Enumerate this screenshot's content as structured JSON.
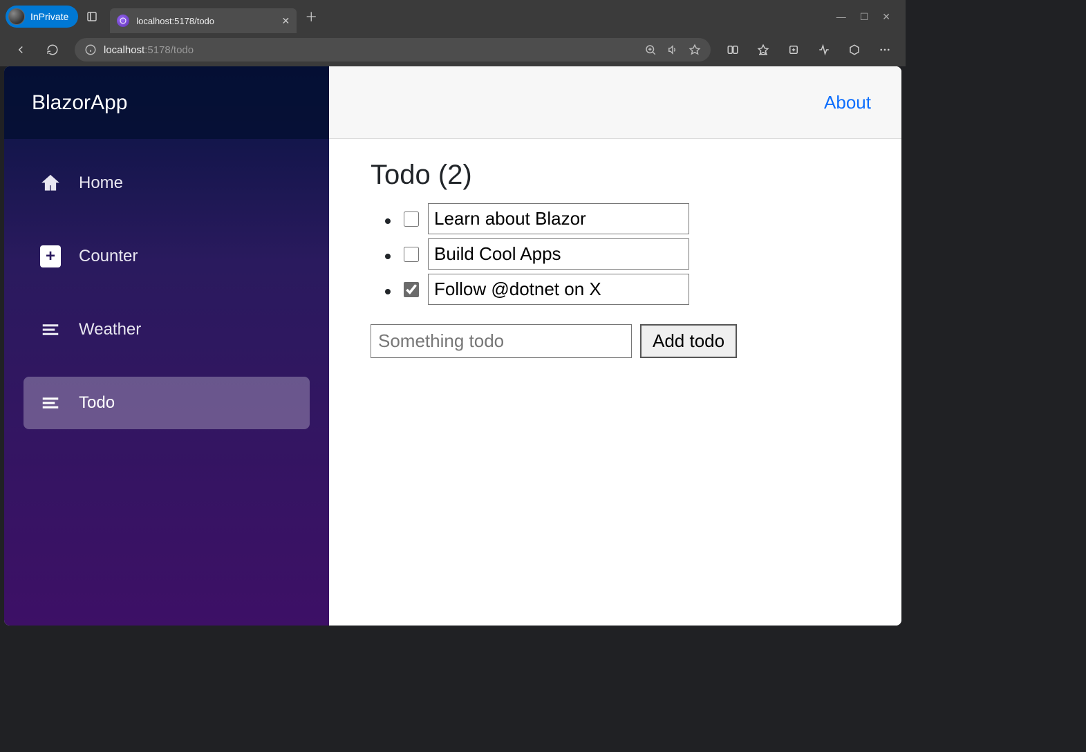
{
  "browser": {
    "inprivate_label": "InPrivate",
    "tab_title": "localhost:5178/todo",
    "address_host": "localhost",
    "address_path": ":5178/todo"
  },
  "sidebar": {
    "brand": "BlazorApp",
    "items": [
      {
        "label": "Home",
        "icon": "home",
        "active": false
      },
      {
        "label": "Counter",
        "icon": "plus",
        "active": false
      },
      {
        "label": "Weather",
        "icon": "list",
        "active": false
      },
      {
        "label": "Todo",
        "icon": "list",
        "active": true
      }
    ]
  },
  "top_row": {
    "about_label": "About"
  },
  "page": {
    "heading": "Todo (2)",
    "todos": [
      {
        "title": "Learn about Blazor",
        "done": false
      },
      {
        "title": "Build Cool Apps",
        "done": false
      },
      {
        "title": "Follow @dotnet on X",
        "done": true
      }
    ],
    "new_placeholder": "Something todo",
    "add_button_label": "Add todo"
  }
}
